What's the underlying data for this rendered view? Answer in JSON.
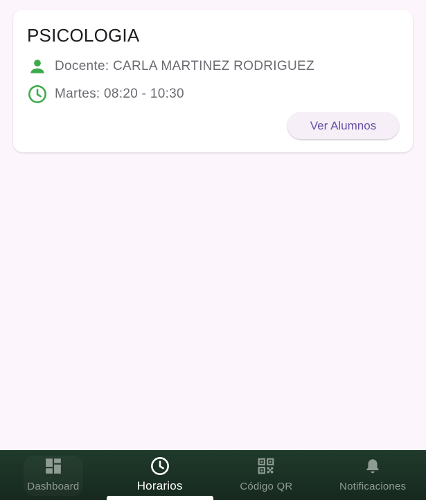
{
  "course": {
    "title": "PSICOLOGIA",
    "teacher": "Docente: CARLA MARTINEZ RODRIGUEZ",
    "schedule": "Martes: 08:20 - 10:30",
    "button_label": "Ver Alumnos",
    "icons": {
      "teacher": "person-icon",
      "schedule": "clock-icon"
    }
  },
  "nav": {
    "items": [
      {
        "label": "Dashboard",
        "icon": "dashboard-icon",
        "active": false
      },
      {
        "label": "Horarios",
        "icon": "clock-icon",
        "active": true
      },
      {
        "label": "Código QR",
        "icon": "qr-code-icon",
        "active": false
      },
      {
        "label": "Notificaciones",
        "icon": "bell-icon",
        "active": false
      }
    ]
  },
  "colors": {
    "background": "#fdf5fc",
    "accent_green": "#3daa4b",
    "button_text": "#6750a4",
    "nav_background": "#1f3a2b"
  }
}
